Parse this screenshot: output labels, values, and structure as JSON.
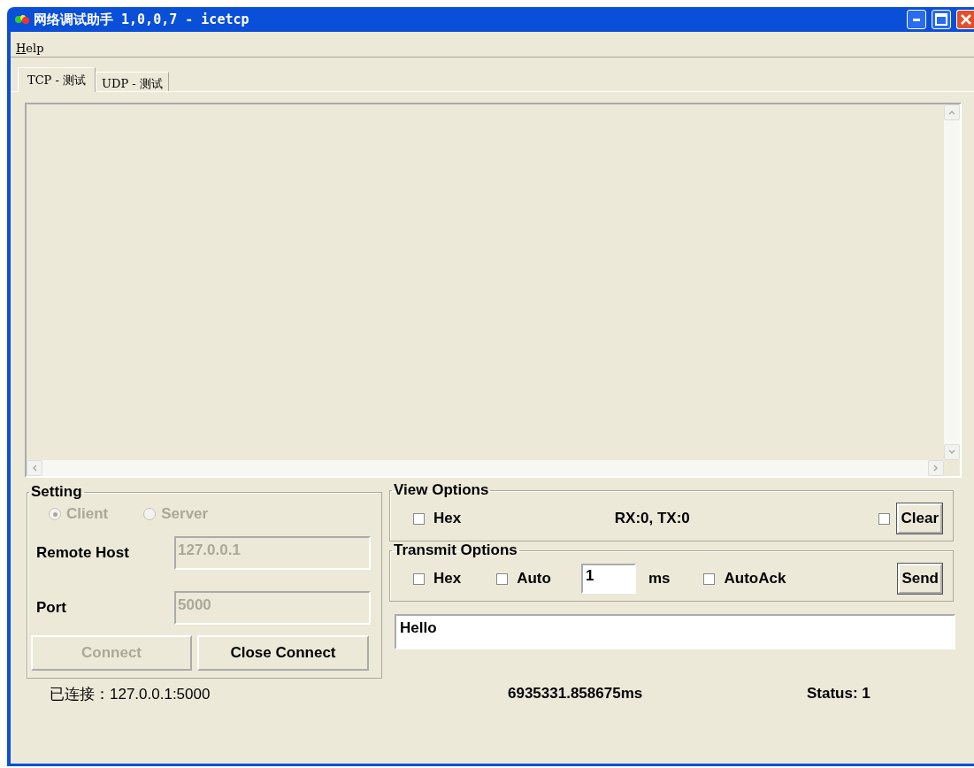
{
  "window": {
    "title": "网络调试助手  1,0,0,7 - icetcp"
  },
  "menu": [
    {
      "label": "Help"
    }
  ],
  "tabs": [
    {
      "label": "TCP -  测试",
      "selected": true
    },
    {
      "label": "UDP - 测试",
      "selected": false
    }
  ],
  "setting": {
    "title": "Setting",
    "modes_disabled": true,
    "modes": [
      {
        "label": "Client",
        "selected": true
      },
      {
        "label": "Server",
        "selected": false
      }
    ],
    "fields": [
      {
        "label": "Remote Host",
        "value": "127.0.0.1",
        "disabled": true
      },
      {
        "label": "Port",
        "value": "5000",
        "disabled": true
      }
    ],
    "buttons": [
      {
        "label": "Connect",
        "disabled": true
      },
      {
        "label": "Close Connect",
        "disabled": false
      }
    ]
  },
  "view_options": {
    "title": "View Options",
    "hex": {
      "label": "Hex",
      "checked": false
    },
    "counter": "RX:0, TX:0",
    "clear_check": {
      "checked": false
    },
    "clear_button": "Clear"
  },
  "transmit_options": {
    "title": "Transmit Options",
    "hex": {
      "label": "Hex",
      "checked": false
    },
    "auto": {
      "label": "Auto",
      "checked": false
    },
    "interval": "1",
    "unit": "ms",
    "autoack": {
      "label": "AutoAck",
      "checked": false
    },
    "send_button": "Send"
  },
  "message": {
    "value": "Hello"
  },
  "status_bar": {
    "connection": "已连接：127.0.0.1:5000",
    "elapsed": "6935331.858675ms",
    "status": "Status: 1"
  }
}
